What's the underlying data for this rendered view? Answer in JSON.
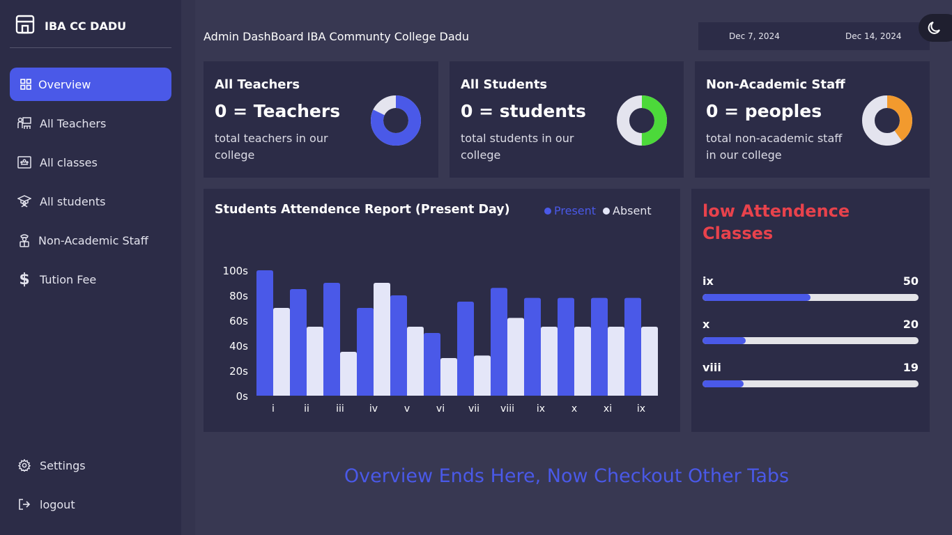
{
  "sidebar": {
    "brand": "IBA CC DADU",
    "items": [
      {
        "label": "Overview",
        "icon": "grid-icon"
      },
      {
        "label": "All Teachers",
        "icon": "teacher-icon"
      },
      {
        "label": "All classes",
        "icon": "classroom-icon"
      },
      {
        "label": "All students",
        "icon": "graduation-cap-icon"
      },
      {
        "label": "Non-Academic Staff",
        "icon": "staff-icon"
      },
      {
        "label": "Tution Fee",
        "icon": "dollar-icon"
      }
    ],
    "bottom": [
      {
        "label": "Settings",
        "icon": "gear-icon"
      },
      {
        "label": "logout",
        "icon": "logout-icon"
      }
    ]
  },
  "header": {
    "title": "Admin DashBoard IBA Communty College Dadu",
    "date_start": "Dec 7, 2024",
    "date_end": "Dec 14, 2024"
  },
  "stats": [
    {
      "title": "All Teachers",
      "value": "0 = Teachers",
      "desc": "total teachers in our college",
      "fraction": 0.82,
      "color": "#4a59e8"
    },
    {
      "title": "All Students",
      "value": "0 = students",
      "desc": "total students in our college",
      "fraction": 0.5,
      "color": "#4cd93a"
    },
    {
      "title": "Non-Academic Staff",
      "value": "0 = peoples",
      "desc": "total non-academic staff in our college",
      "fraction": 0.4,
      "color": "#f29a2e"
    }
  ],
  "attendance": {
    "title": "Students Attendence Report (Present Day)",
    "legend_present": "Present",
    "legend_absent": "Absent"
  },
  "chart_data": {
    "type": "bar",
    "categories": [
      "i",
      "ii",
      "iii",
      "iv",
      "v",
      "vi",
      "vii",
      "viii",
      "ix",
      "x",
      "xi",
      "ix"
    ],
    "series": [
      {
        "name": "Present",
        "values": [
          100,
          85,
          90,
          70,
          80,
          50,
          75,
          86,
          78,
          78,
          78,
          78
        ],
        "color": "#4a59e8"
      },
      {
        "name": "Absent",
        "values": [
          70,
          55,
          35,
          90,
          55,
          30,
          32,
          62,
          55,
          55,
          55,
          55
        ],
        "color": "#e4e6f8"
      }
    ],
    "yticks": [
      "0s",
      "20s",
      "40s",
      "60s",
      "80s",
      "100s"
    ],
    "ylim": [
      0,
      100
    ],
    "grid": false,
    "legend": "top-right"
  },
  "low_attendance": {
    "title": "low Attendence Classes",
    "rows": [
      {
        "label": "ix",
        "value": "50",
        "fraction": 0.5
      },
      {
        "label": "x",
        "value": "20",
        "fraction": 0.2
      },
      {
        "label": "viii",
        "value": "19",
        "fraction": 0.19
      }
    ]
  },
  "footer_note": "Overview Ends Here, Now Checkout Other Tabs"
}
